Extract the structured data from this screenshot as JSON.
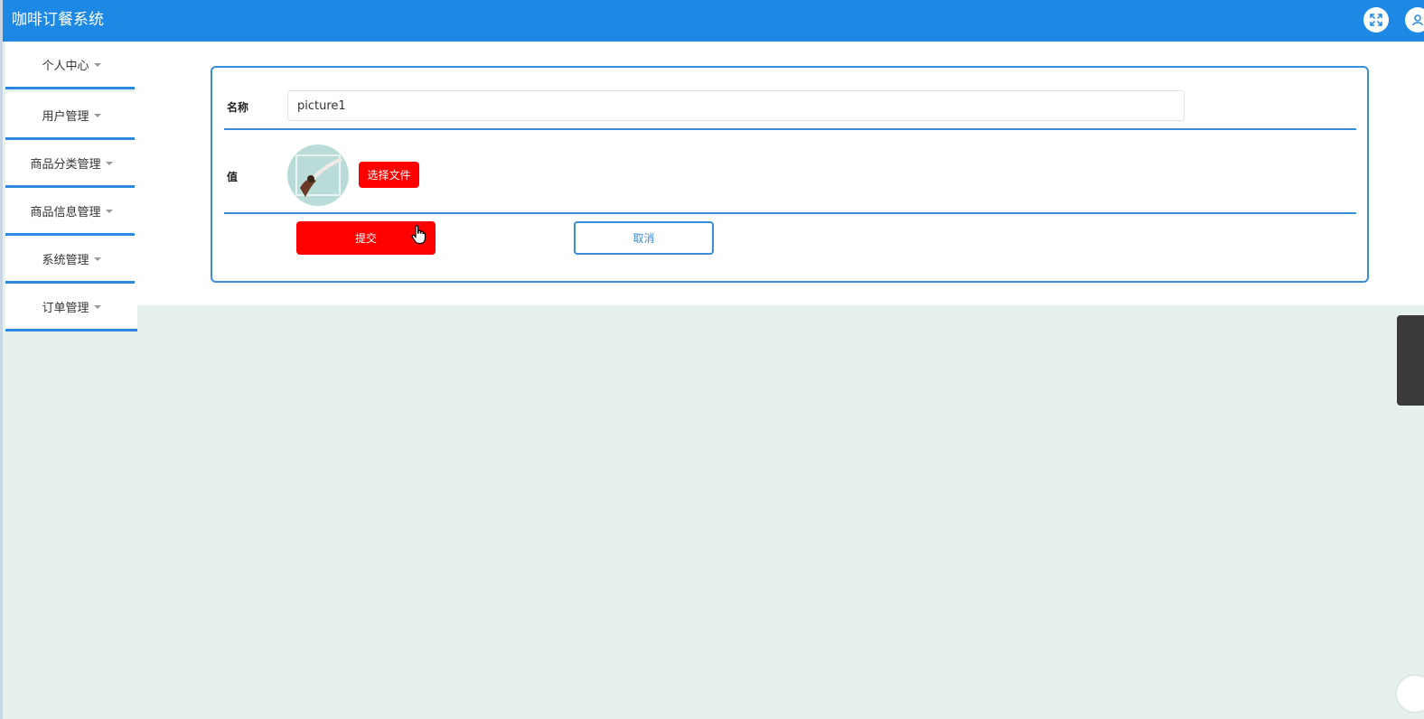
{
  "app": {
    "title": "咖啡订餐系统"
  },
  "header": {
    "icons": [
      "fullscreen-icon",
      "user-icon"
    ]
  },
  "sidebar": {
    "items": [
      {
        "label": "个人中心"
      },
      {
        "label": "用户管理"
      },
      {
        "label": "商品分类管理"
      },
      {
        "label": "商品信息管理"
      },
      {
        "label": "系统管理"
      },
      {
        "label": "订单管理"
      }
    ]
  },
  "form": {
    "name_label": "名称",
    "name_value": "picture1",
    "value_label": "值",
    "choose_file_label": "选择文件",
    "submit_label": "提交",
    "cancel_label": "取消"
  },
  "colors": {
    "header": "#1e88e5",
    "accent": "#3a8ed8",
    "danger": "#ff0000",
    "background": "#e7f1ec"
  }
}
